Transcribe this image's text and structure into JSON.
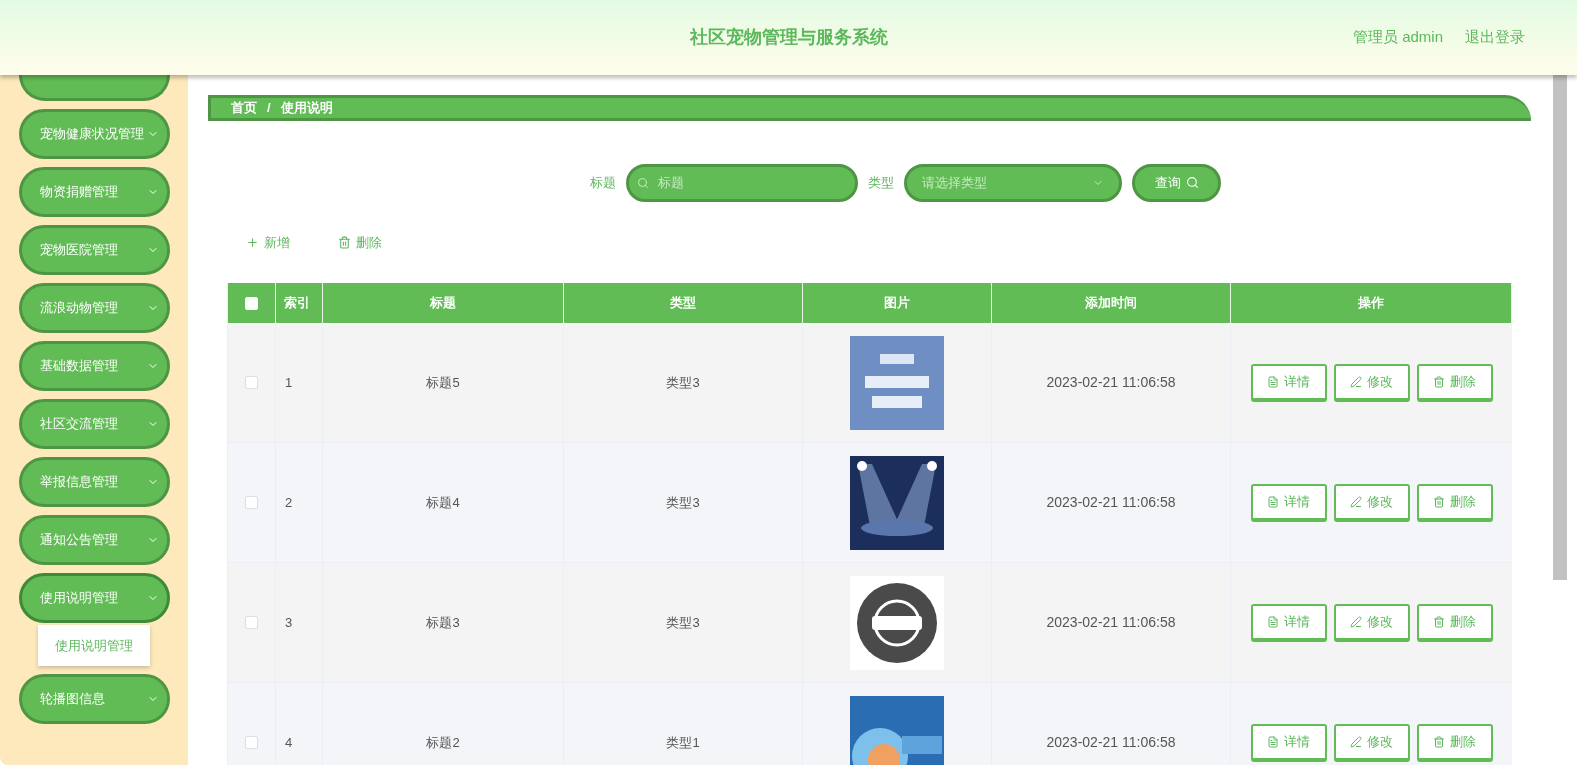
{
  "header": {
    "title": "社区宠物管理与服务系统",
    "user": "管理员 admin",
    "logout": "退出登录"
  },
  "sidebar": {
    "items": [
      {
        "label": "宠物健康状况管理",
        "expanded": false
      },
      {
        "label": "物资捐赠管理",
        "expanded": false
      },
      {
        "label": "宠物医院管理",
        "expanded": false
      },
      {
        "label": "流浪动物管理",
        "expanded": false
      },
      {
        "label": "基础数据管理",
        "expanded": false
      },
      {
        "label": "社区交流管理",
        "expanded": false
      },
      {
        "label": "举报信息管理",
        "expanded": false
      },
      {
        "label": "通知公告管理",
        "expanded": false
      },
      {
        "label": "使用说明管理",
        "expanded": true,
        "children": [
          {
            "label": "使用说明管理"
          }
        ]
      },
      {
        "label": "轮播图信息",
        "expanded": false
      }
    ]
  },
  "breadcrumb": {
    "items": [
      "首页",
      "使用说明"
    ],
    "separator": "/"
  },
  "search": {
    "title_label": "标题",
    "title_placeholder": "标题",
    "type_label": "类型",
    "type_placeholder": "请选择类型",
    "query_button": "查询"
  },
  "actions": {
    "add": "新增",
    "delete": "删除"
  },
  "table": {
    "select_all_checked": false,
    "columns": [
      "索引",
      "标题",
      "类型",
      "图片",
      "添加时间",
      "操作"
    ],
    "rows": [
      {
        "index": "1",
        "title": "标题5",
        "type": "类型3",
        "time": "2023-02-21 11:06:58",
        "checked": false,
        "buttons": [
          "详情",
          "修改",
          "删除"
        ]
      },
      {
        "index": "2",
        "title": "标题4",
        "type": "类型3",
        "time": "2023-02-21 11:06:58",
        "checked": false,
        "buttons": [
          "详情",
          "修改",
          "删除"
        ]
      },
      {
        "index": "3",
        "title": "标题3",
        "type": "类型3",
        "time": "2023-02-21 11:06:58",
        "checked": false,
        "buttons": [
          "详情",
          "修改",
          "删除"
        ]
      },
      {
        "index": "4",
        "title": "标题2",
        "type": "类型1",
        "time": "2023-02-21 11:06:58",
        "checked": false,
        "buttons": [
          "详情",
          "修改",
          "删除"
        ]
      }
    ]
  }
}
